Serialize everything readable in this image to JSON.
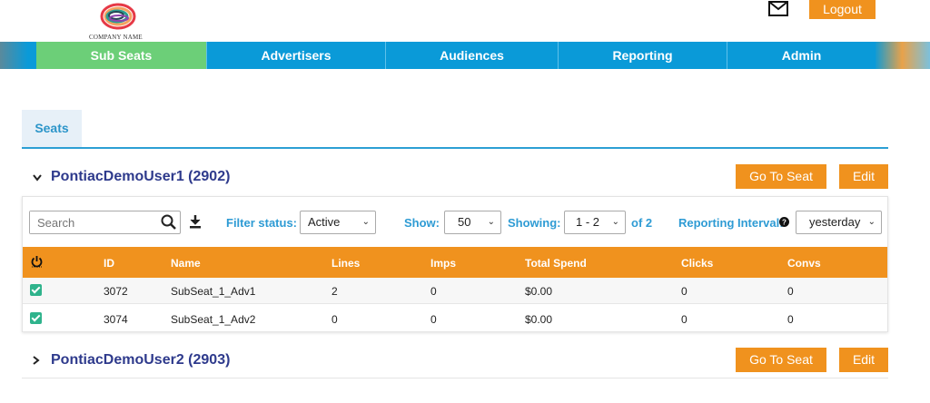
{
  "header": {
    "company_name": "COMPANY NAME",
    "logout_label": "Logout",
    "icons": [
      "logo",
      "mail-icon"
    ]
  },
  "nav": {
    "items": [
      {
        "label": "Sub Seats",
        "active": true
      },
      {
        "label": "Advertisers",
        "active": false
      },
      {
        "label": "Audiences",
        "active": false
      },
      {
        "label": "Reporting",
        "active": false
      },
      {
        "label": "Admin",
        "active": false
      }
    ]
  },
  "tabs": [
    {
      "label": "Seats",
      "active": true
    }
  ],
  "seats": [
    {
      "title": "PontiacDemoUser1 (2902)",
      "expanded": true,
      "go_label": "Go To Seat",
      "edit_label": "Edit"
    },
    {
      "title": "PontiacDemoUser2 (2903)",
      "expanded": false,
      "go_label": "Go To Seat",
      "edit_label": "Edit"
    }
  ],
  "toolbar": {
    "search_placeholder": "Search",
    "filter_status_label": "Filter status:",
    "filter_status_value": "Active",
    "show_label": "Show:",
    "show_value": "50",
    "showing_label": "Showing:",
    "showing_value": "1 - 2",
    "of_total": "of 2",
    "reporting_interval_label": "Reporting Interval:",
    "reporting_interval_value": "yesterday"
  },
  "table": {
    "columns": [
      "ID",
      "Name",
      "Lines",
      "Imps",
      "Total Spend",
      "Clicks",
      "Convs"
    ],
    "rows": [
      {
        "checked": true,
        "id": "3072",
        "name": "SubSeat_1_Adv1",
        "lines": "2",
        "imps": "0",
        "total_spend": "$0.00",
        "clicks": "0",
        "convs": "0"
      },
      {
        "checked": true,
        "id": "3074",
        "name": "SubSeat_1_Adv2",
        "lines": "0",
        "imps": "0",
        "total_spend": "$0.00",
        "clicks": "0",
        "convs": "0"
      }
    ]
  },
  "colors": {
    "accent_orange": "#f0921e",
    "nav_blue": "#0a9ad8",
    "nav_active_green": "#6ccf78",
    "title_navy": "#2e3a8c",
    "label_blue": "#2e9bd4",
    "checkbox_green": "#2fb38c"
  }
}
